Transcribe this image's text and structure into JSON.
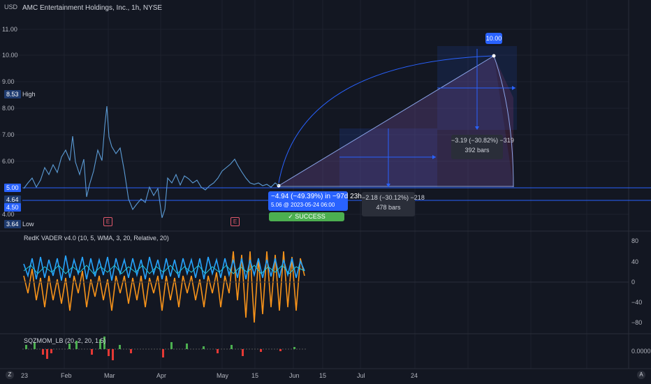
{
  "header": {
    "currency": "USD",
    "title": "AMC Entertainment Holdings, Inc., 1h, NYSE"
  },
  "price_axis": {
    "labels": [
      "11.00",
      "10.00",
      "9.00",
      "8.00",
      "7.00",
      "6.00",
      "5.00",
      "4.00"
    ]
  },
  "price_tags": {
    "high_value": "8.53",
    "high_label": "High",
    "current": "5.00",
    "p1": "4.64",
    "p2": "4.50",
    "low_value": "3.64",
    "low_label": "Low"
  },
  "target_badge": "10.00",
  "annotations": {
    "main_stat": "−4.94 (−49.39%) in −97d 23h",
    "main_sub": "5.06 @ 2023-05-24  06:00",
    "success": "✓ SUCCESS",
    "box1_line1": "−3.19 (−30.82%) −319",
    "box1_line2": "392 bars",
    "box2_line1": "−2.18 (−30.12%) −218",
    "box2_line2": "478 bars"
  },
  "earnings_badge": "E",
  "vader": {
    "title": "RedK VADER v4.0 (10, 5, WMA, 3, 20, Relative, 20)",
    "axis": [
      "80",
      "40",
      "0",
      "−40",
      "−80"
    ]
  },
  "sqz": {
    "title": "SQZMOM_LB (20, 2, 20, 1.5)",
    "axis": "0.0000"
  },
  "time_axis": [
    "23",
    "Feb",
    "Mar",
    "Apr",
    "May",
    "15",
    "Jun",
    "15",
    "Jul",
    "24"
  ],
  "footer": {
    "left": "Z",
    "right": "A"
  },
  "colors": {
    "bg": "#131722",
    "price": "#5b9bd5",
    "blue": "#2962ff",
    "green": "#4caf50",
    "orange": "#f7931a",
    "teal": "#26c6da",
    "red": "#e53935"
  }
}
